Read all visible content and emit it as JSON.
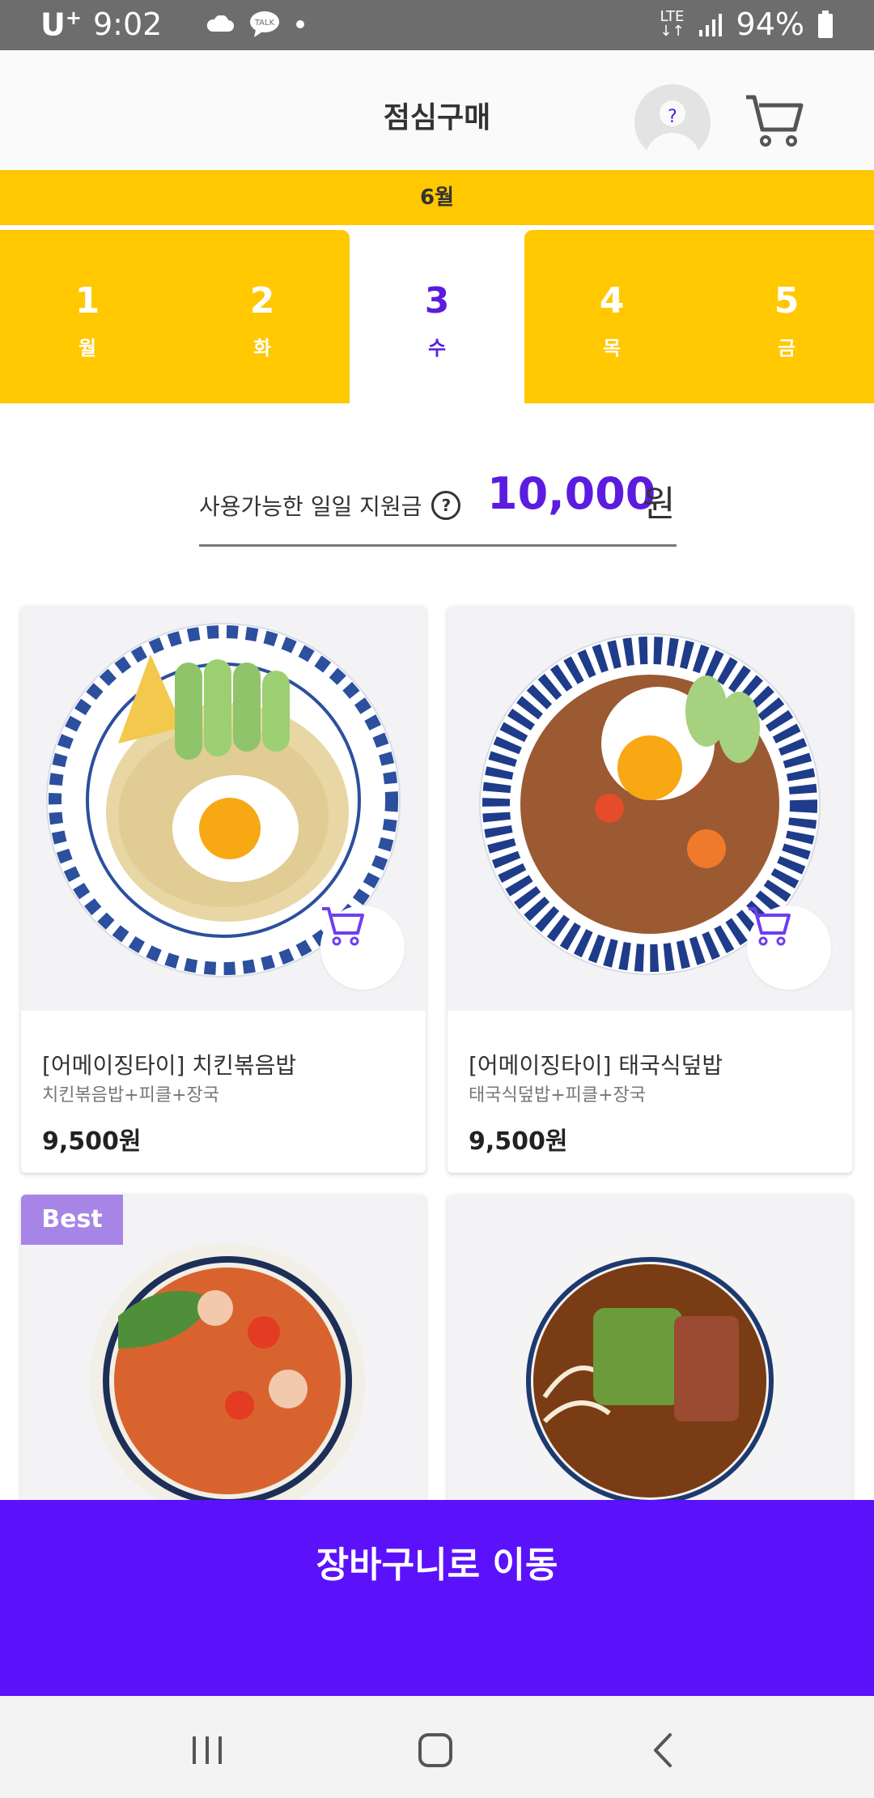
{
  "status": {
    "carrier": "U",
    "carrier_sup": "+",
    "time": "9:02",
    "network": "LTE",
    "battery": "94%",
    "icons": [
      "cloud-icon",
      "kakaotalk-icon",
      "dot-icon",
      "signal-icon",
      "battery-icon"
    ]
  },
  "header": {
    "title": "점심구매",
    "avatar_mark": "?",
    "cart_icon": "cart-icon"
  },
  "calendar": {
    "month": "6월",
    "days": [
      {
        "num": "1",
        "weekday": "월"
      },
      {
        "num": "2",
        "weekday": "화"
      },
      {
        "num": "3",
        "weekday": "수",
        "selected": true
      },
      {
        "num": "4",
        "weekday": "목"
      },
      {
        "num": "5",
        "weekday": "금"
      }
    ]
  },
  "allowance": {
    "label": "사용가능한 일일 지원금",
    "help_mark": "?",
    "amount": "10,000",
    "unit": "원"
  },
  "menu": [
    {
      "name": "[어메이징타이] 치킨볶음밥",
      "desc": "치킨볶음밥+피클+장국",
      "price": "9,500원",
      "badge": ""
    },
    {
      "name": "[어메이징타이] 태국식덮밥",
      "desc": "태국식덮밥+피클+장국",
      "price": "9,500원",
      "badge": ""
    },
    {
      "name": "",
      "desc": "",
      "price": "",
      "badge": "Best"
    },
    {
      "name": "",
      "desc": "",
      "price": "",
      "badge": ""
    }
  ],
  "footer": {
    "go_cart_label": "장바구니로 이동"
  },
  "colors": {
    "accent": "#5b12fa",
    "yellow": "#ffc800",
    "best_badge": "#a785e6",
    "status_bar": "#6d6d6d"
  }
}
